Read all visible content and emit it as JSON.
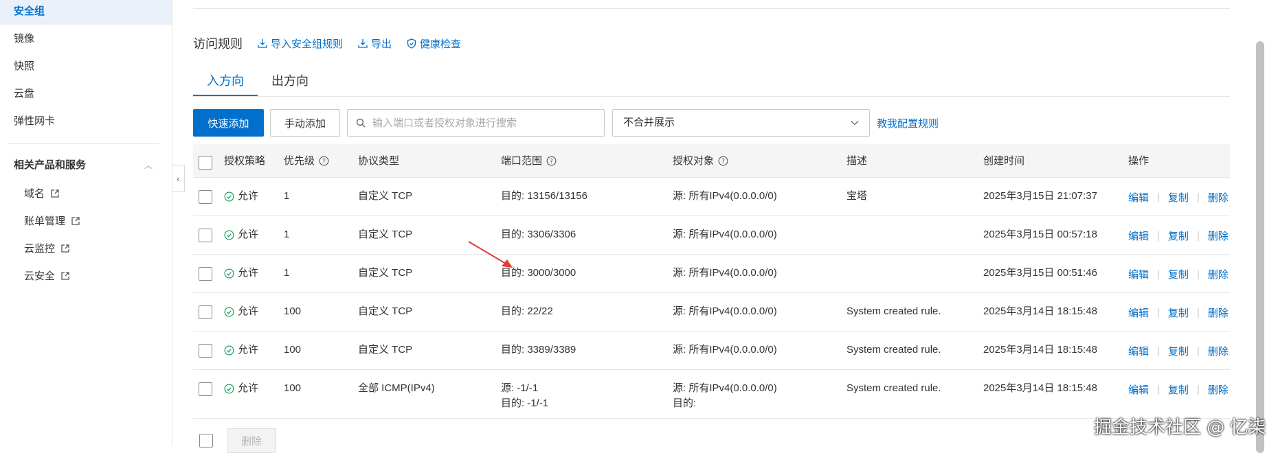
{
  "sidebar": {
    "items": [
      "安全组",
      "镜像",
      "快照",
      "云盘",
      "弹性网卡"
    ],
    "group_title": "相关产品和服务",
    "sub_items": [
      "域名",
      "账单管理",
      "云监控",
      "云安全"
    ]
  },
  "section": {
    "title": "访问规则",
    "import_label": "导入安全组规则",
    "export_label": "导出",
    "health_label": "健康检查"
  },
  "tabs": [
    "入方向",
    "出方向"
  ],
  "toolbar": {
    "quick_add": "快速添加",
    "manual_add": "手动添加",
    "search_placeholder": "输入端口或者授权对象进行搜索",
    "merge_select": "不合并展示",
    "help_link": "教我配置规则"
  },
  "table": {
    "headers": [
      "授权策略",
      "优先级",
      "协议类型",
      "端口范围",
      "授权对象",
      "描述",
      "创建时间",
      "操作"
    ],
    "rows": [
      {
        "policy": "允许",
        "priority": "1",
        "protocol": "自定义 TCP",
        "port1": "目的: 13156/13156",
        "port2": "",
        "object1": "源: 所有IPv4(0.0.0.0/0)",
        "object2": "",
        "desc": "宝塔",
        "time": "2025年3月15日 21:07:37"
      },
      {
        "policy": "允许",
        "priority": "1",
        "protocol": "自定义 TCP",
        "port1": "目的: 3306/3306",
        "port2": "",
        "object1": "源: 所有IPv4(0.0.0.0/0)",
        "object2": "",
        "desc": "",
        "time": "2025年3月15日 00:57:18"
      },
      {
        "policy": "允许",
        "priority": "1",
        "protocol": "自定义 TCP",
        "port1": "目的: 3000/3000",
        "port2": "",
        "object1": "源: 所有IPv4(0.0.0.0/0)",
        "object2": "",
        "desc": "",
        "time": "2025年3月15日 00:51:46"
      },
      {
        "policy": "允许",
        "priority": "100",
        "protocol": "自定义 TCP",
        "port1": "目的: 22/22",
        "port2": "",
        "object1": "源: 所有IPv4(0.0.0.0/0)",
        "object2": "",
        "desc": "System created rule.",
        "time": "2025年3月14日 18:15:48"
      },
      {
        "policy": "允许",
        "priority": "100",
        "protocol": "自定义 TCP",
        "port1": "目的: 3389/3389",
        "port2": "",
        "object1": "源: 所有IPv4(0.0.0.0/0)",
        "object2": "",
        "desc": "System created rule.",
        "time": "2025年3月14日 18:15:48"
      },
      {
        "policy": "允许",
        "priority": "100",
        "protocol": "全部 ICMP(IPv4)",
        "port1": "源: -1/-1",
        "port2": "目的: -1/-1",
        "object1": "源: 所有IPv4(0.0.0.0/0)",
        "object2": "目的:",
        "desc": "System created rule.",
        "time": "2025年3月14日 18:15:48"
      }
    ],
    "ops": [
      "编辑",
      "复制",
      "删除"
    ]
  },
  "footer": {
    "delete_label": "删除"
  },
  "watermark": "掘金技术社区 @ 忆柒",
  "colors": {
    "primary": "#0070cc",
    "success": "#1aa35f",
    "annotation_arrow": "#e53935"
  }
}
